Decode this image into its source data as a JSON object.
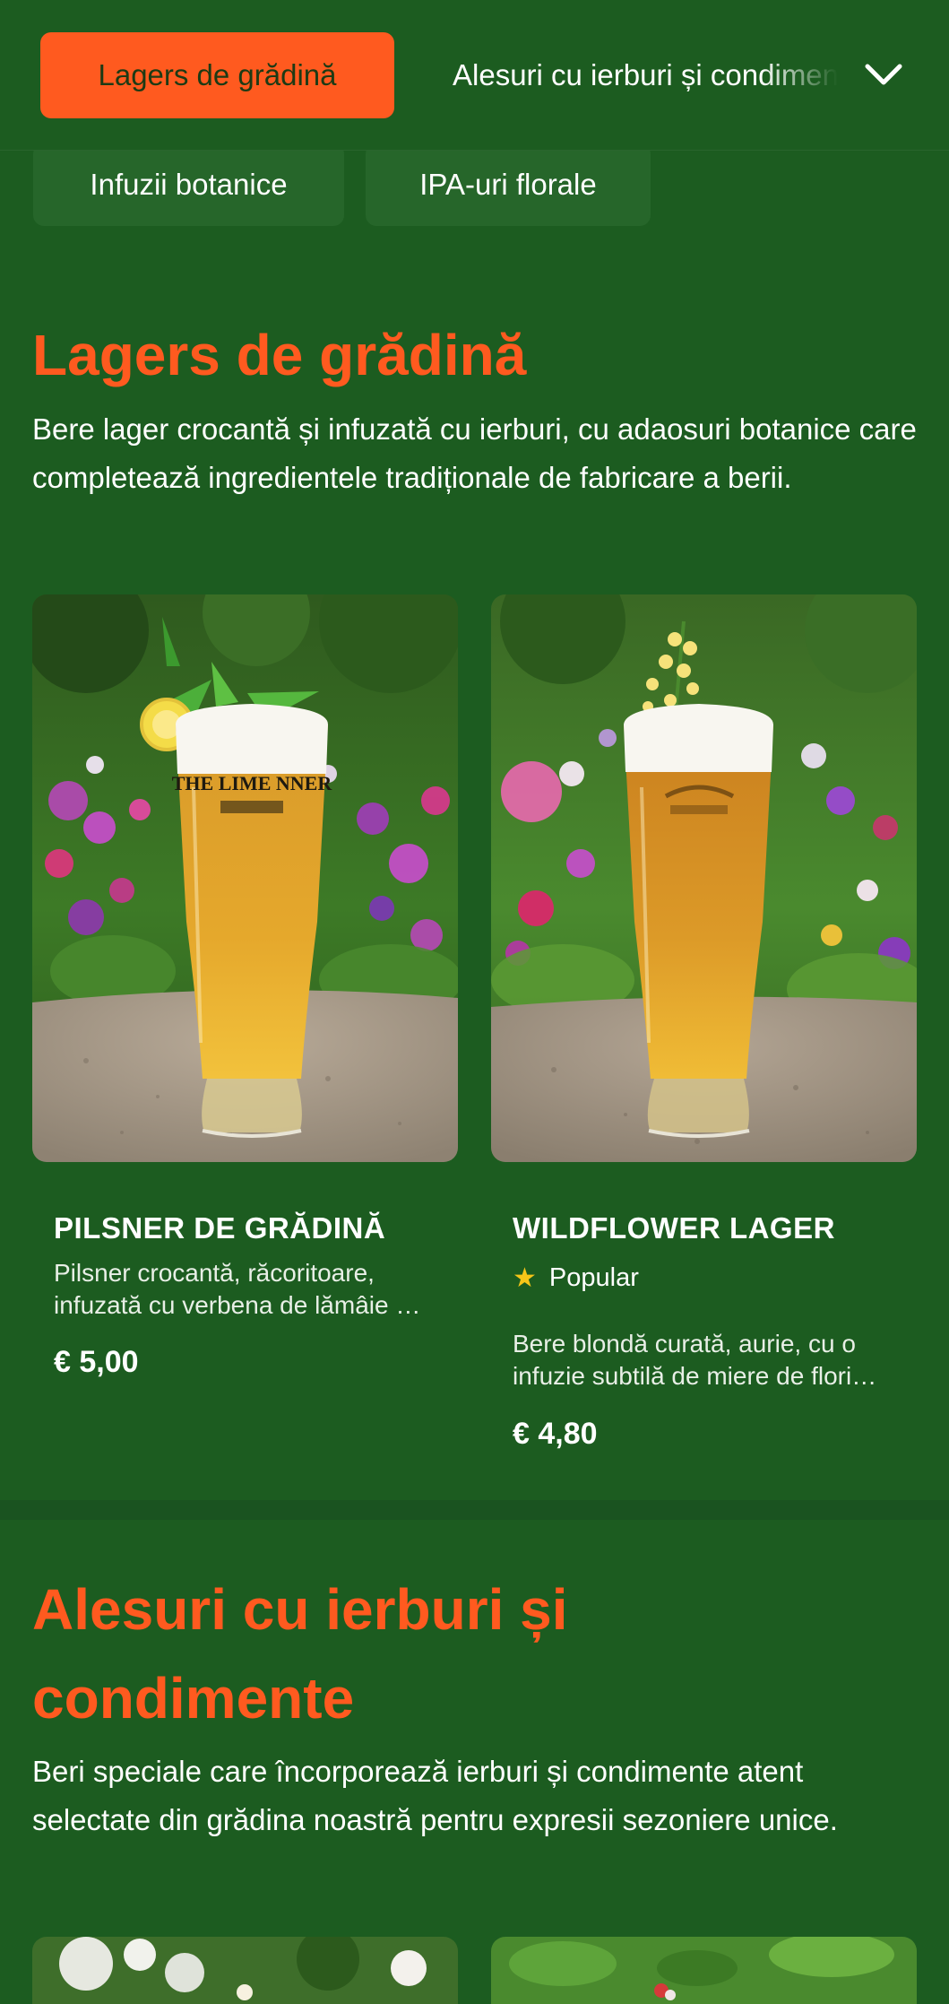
{
  "nav": {
    "active_category": "Lagers de grădină",
    "next_category": "Alesuri cu ierburi și condimente",
    "row2": [
      "Infuzii botanice",
      "IPA-uri florale"
    ]
  },
  "sections": [
    {
      "title": "Lagers de grădină",
      "description": "Bere lager crocantă și infuzată cu ierburi, cu adaosuri botanice care completează ingredientele tradiționale de fabricare a berii.",
      "products": [
        {
          "name": "PILSNER DE GRĂDINĂ",
          "description": "Pilsner crocantă, răcoritoare, infuzată cu verbena de lămâie și flori de soc.",
          "price": "€ 5,00",
          "glass_logo": "THE LIME NNER"
        },
        {
          "name": "WILDFLOWER LAGER",
          "badge": "Popular",
          "description": "Bere blondă curată, aurie, cu o infuzie subtilă de miere de flori sălbatice.",
          "price": "€ 4,80"
        }
      ]
    },
    {
      "title_line1": "Alesuri cu ierburi și",
      "title_line2": "condimente",
      "description": "Beri speciale care încorporează ierburi și condimente atent selectate din grădina noastră pentru expresii sezoniere unice."
    }
  ],
  "colors": {
    "background": "#1c5c20",
    "accent": "#ff5a1f",
    "chip": "#26662a",
    "star": "#f5c518"
  },
  "icons": {
    "dropdown": "chevron-down-icon",
    "badge": "star-icon"
  }
}
